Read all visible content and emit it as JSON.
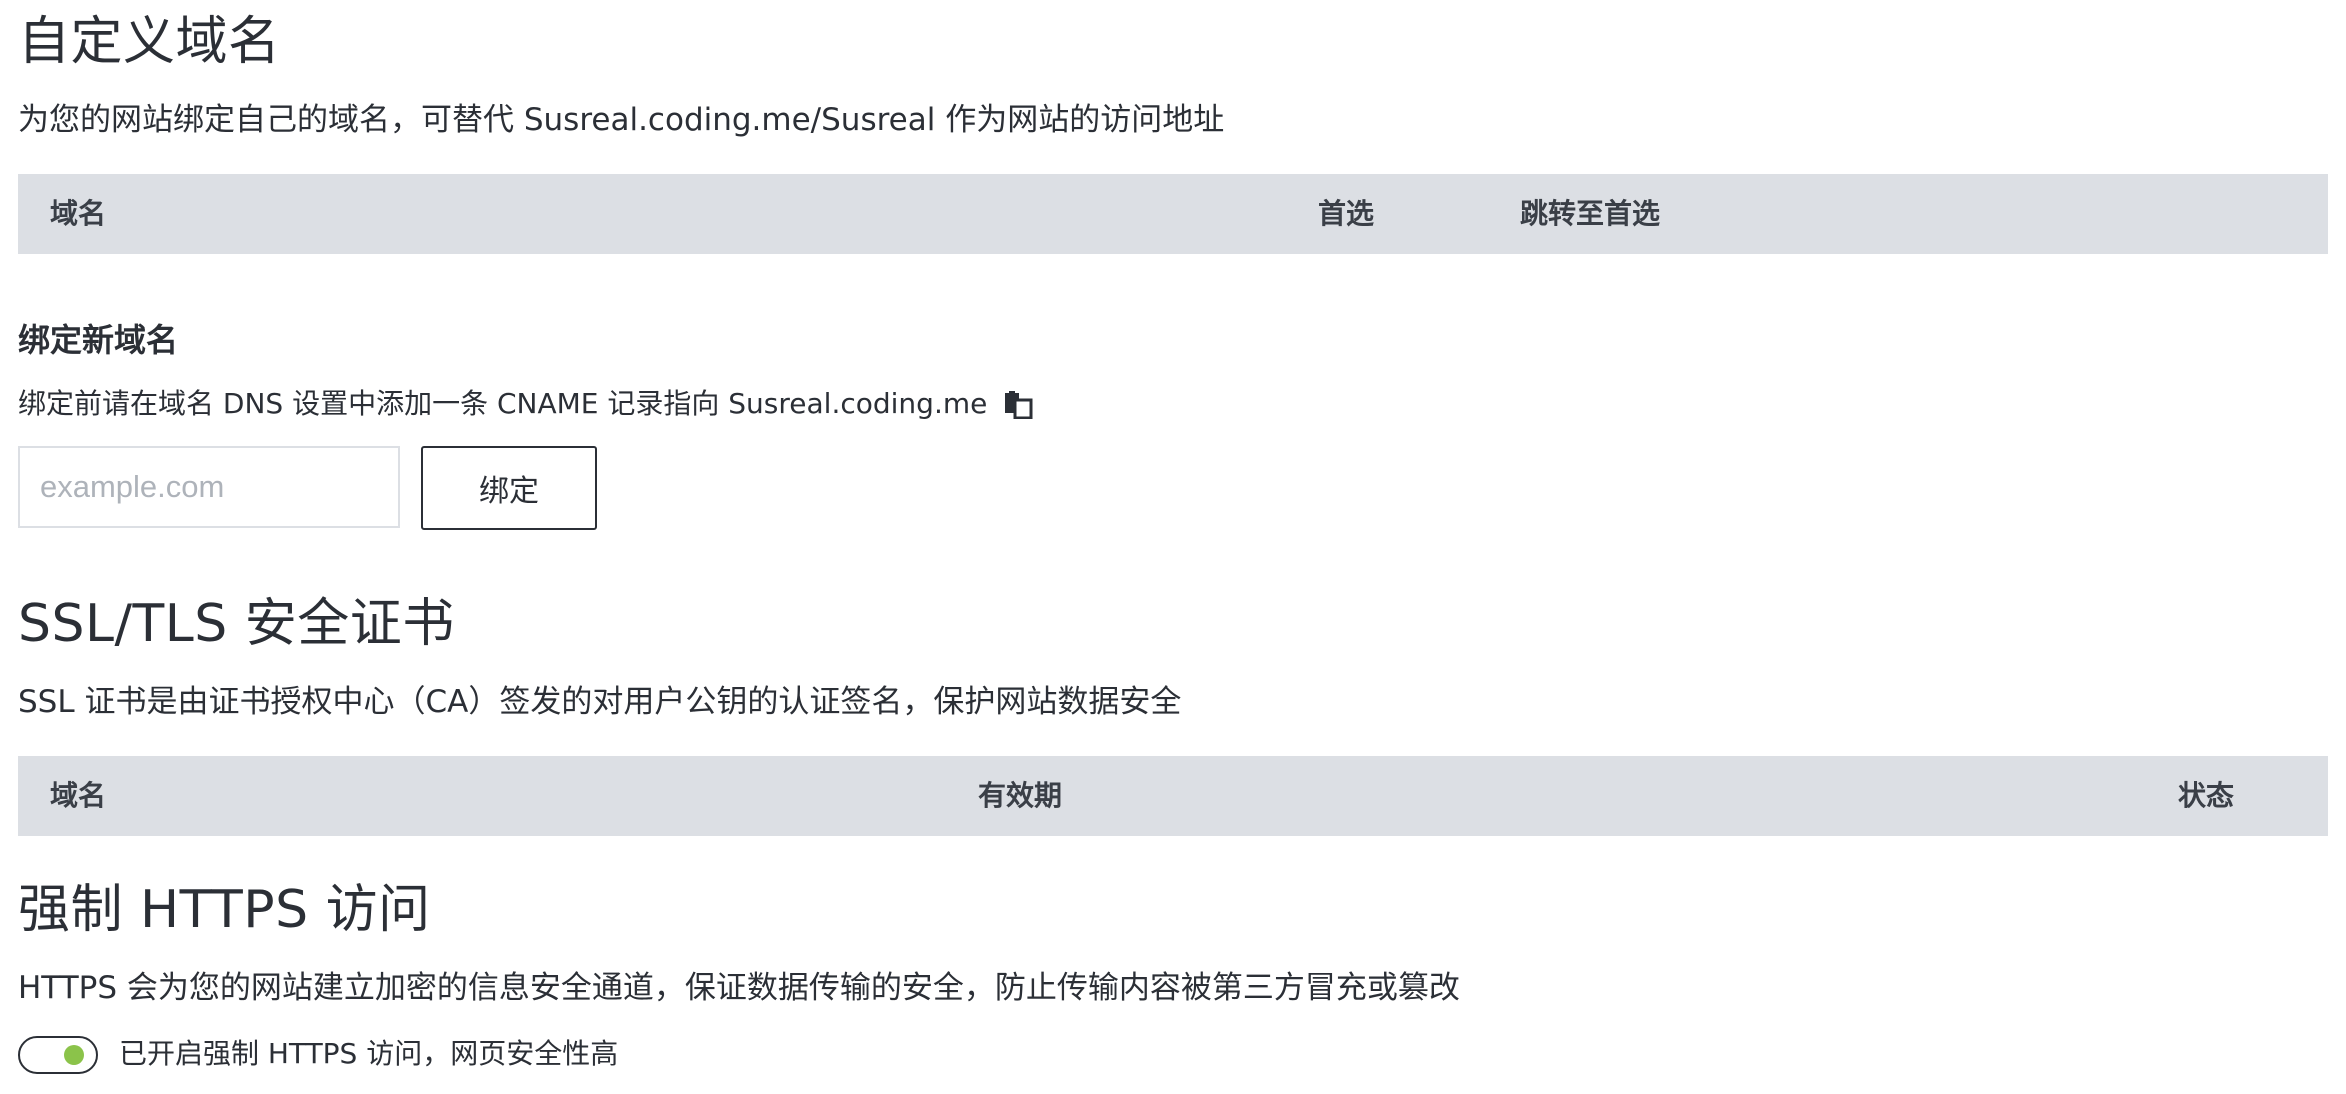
{
  "custom_domain": {
    "title": "自定义域名",
    "description": "为您的网站绑定自己的域名，可替代 Susreal.coding.me/Susreal 作为网站的访问地址",
    "table_headers": {
      "domain": "域名",
      "preferred": "首选",
      "redirect": "跳转至首选"
    }
  },
  "bind_new": {
    "title": "绑定新域名",
    "note": "绑定前请在域名 DNS 设置中添加一条 CNAME 记录指向 Susreal.coding.me",
    "copy_icon": "copy-icon",
    "input_placeholder": "example.com",
    "input_value": "",
    "button_label": "绑定"
  },
  "ssl": {
    "title": "SSL/TLS 安全证书",
    "description": "SSL 证书是由证书授权中心（CA）签发的对用户公钥的认证签名，保护网站数据安全",
    "table_headers": {
      "domain": "域名",
      "validity": "有效期",
      "status": "状态"
    }
  },
  "https": {
    "title": "强制 HTTPS 访问",
    "description": "HTTPS 会为您的网站建立加密的信息安全通道，保证数据传输的安全，防止传输内容被第三方冒充或篡改",
    "toggle_on": true,
    "toggle_label": "已开启强制 HTTPS 访问，网页安全性高"
  },
  "colors": {
    "table_header_bg": "#dcdfe4",
    "text": "#2b2f36",
    "toggle_on": "#8bc34a",
    "placeholder": "#aeb3ba"
  }
}
